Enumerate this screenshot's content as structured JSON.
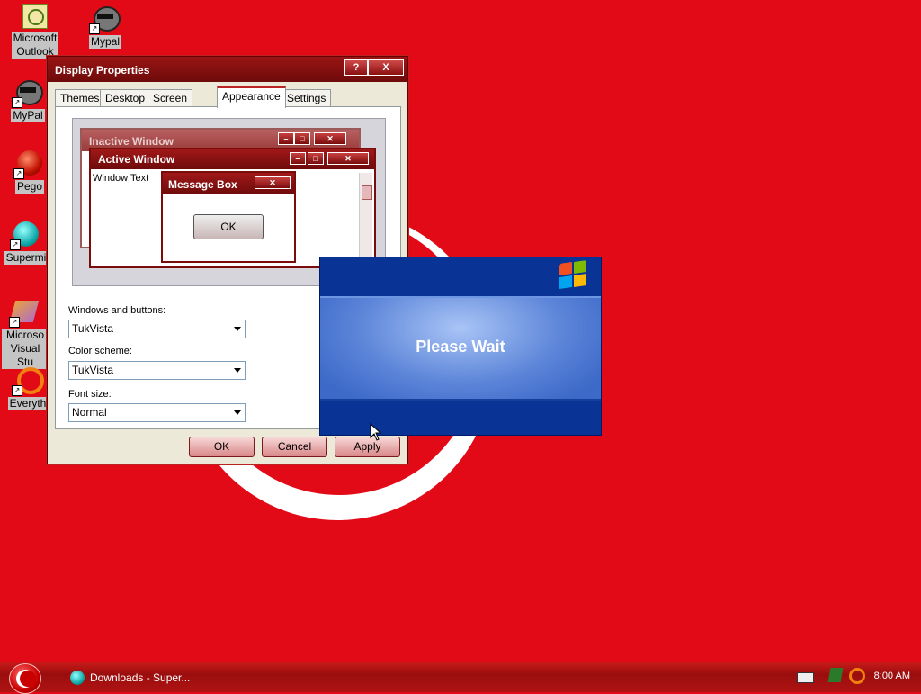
{
  "desktop": {
    "icons": [
      {
        "label": "Microsoft\nOutlook",
        "label_line1": "Microsoft",
        "label_line2": "Outlook"
      },
      {
        "label": "Mypal"
      },
      {
        "label": "MyPal"
      },
      {
        "label": "Pego"
      },
      {
        "label": "Supermi"
      },
      {
        "label_line1": "Microso",
        "label_line2": "Visual Stu"
      },
      {
        "label": "Everyth"
      }
    ]
  },
  "dialog": {
    "title": "Display Properties",
    "help_btn": "?",
    "close_btn": "X",
    "tabs": [
      "Themes",
      "Desktop",
      "Screen Saver",
      "Appearance",
      "Settings"
    ],
    "preview": {
      "inactive_title": "Inactive Window",
      "active_title": "Active Window",
      "window_text": "Window Text",
      "msgbox_title": "Message Box",
      "msgbox_ok": "OK"
    },
    "fields": {
      "windows_label": "Windows and buttons:",
      "windows_value": "TukVista",
      "scheme_label": "Color scheme:",
      "scheme_value": "TukVista",
      "font_label": "Font size:",
      "font_value": "Normal"
    },
    "buttons": {
      "ok": "OK",
      "cancel": "Cancel",
      "apply": "Apply"
    }
  },
  "please_wait": {
    "message": "Please Wait"
  },
  "taskbar": {
    "task_label": "Downloads - Super...",
    "time": "8:00 AM"
  },
  "colors": {
    "wallpaper": "#e30a17",
    "taskbar": "#b01313",
    "wait_blue": "#0a3396"
  }
}
